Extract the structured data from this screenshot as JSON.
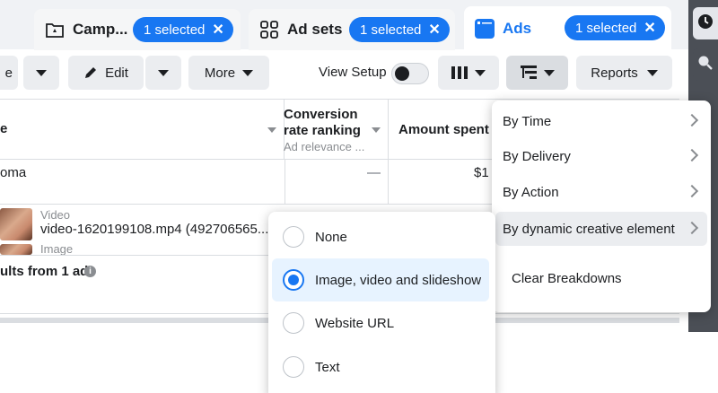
{
  "tabs": [
    {
      "label": "Camp...",
      "pill": "1 selected",
      "icon": "folder-icon"
    },
    {
      "label": "Ad sets",
      "pill": "1 selected",
      "icon": "grid-icon"
    },
    {
      "label": "Ads",
      "pill": "1 selected",
      "icon": "ad-icon"
    }
  ],
  "pill_close": "✕",
  "toolbar": {
    "partial_label": "e",
    "edit_label": "Edit",
    "more_label": "More",
    "view_setup_label": "View Setup",
    "reports_label": "Reports"
  },
  "table": {
    "name_header_partial": "e",
    "conv_header_line1": "Conversion",
    "conv_header_line2": "rate ranking",
    "conv_header_sub": "Ad relevance ...",
    "amount_header": "Amount spent",
    "row1_name": "oma",
    "row1_conv": "—",
    "row1_amount": "$1",
    "row2_type": "Video",
    "row2_name": "video-1620199108.mp4 (492706565...",
    "row3_type": "Image",
    "results_text": "ults from 1 ad"
  },
  "breakdown_menu": {
    "items": [
      "By Time",
      "By Delivery",
      "By Action",
      "By dynamic creative element"
    ],
    "clear_label": "Clear Breakdowns"
  },
  "submenu": {
    "options": [
      "None",
      "Image, video and slideshow",
      "Website URL",
      "Text"
    ],
    "selected": "Image, video and slideshow"
  },
  "colors": {
    "accent": "#1877f2",
    "rail": "#4b4f56",
    "selected_bg": "#e7f3ff"
  }
}
